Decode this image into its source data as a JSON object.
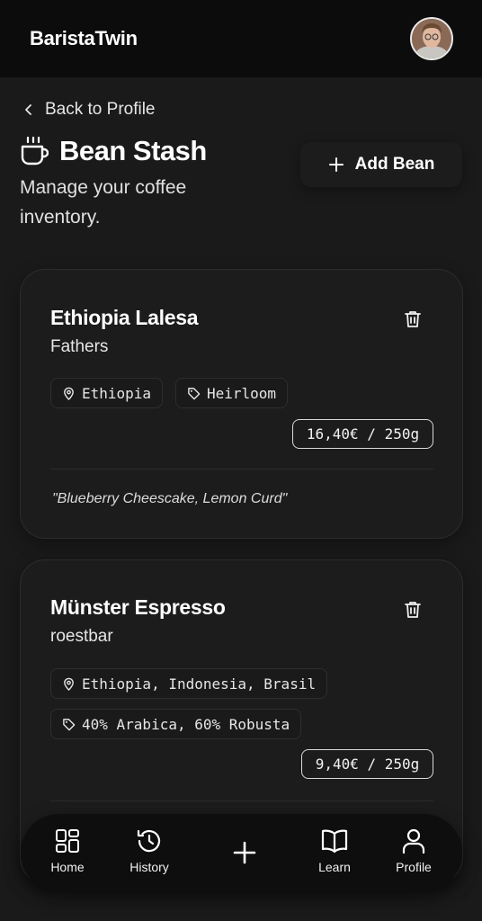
{
  "header": {
    "app_name": "BaristaTwin"
  },
  "page": {
    "back_label": "Back to Profile",
    "title": "Bean Stash",
    "subtitle": "Manage your coffee inventory.",
    "add_button": "Add Bean"
  },
  "beans": [
    {
      "name": "Ethiopia Lalesa",
      "roaster": "Fathers",
      "origin": "Ethiopia",
      "variety": "Heirloom",
      "price": "16,40€ / 250g",
      "notes": "\"Blueberry Cheescake, Lemon Curd\""
    },
    {
      "name": "Münster Espresso",
      "roaster": "roestbar",
      "origin": "Ethiopia, Indonesia, Brasil",
      "variety": "40% Arabica, 60% Robusta",
      "price": "9,40€ / 250g"
    }
  ],
  "nav": {
    "home": "Home",
    "history": "History",
    "learn": "Learn",
    "profile": "Profile"
  },
  "icons": [
    "chevron-left-icon",
    "coffee-cup-icon",
    "plus-icon",
    "trash-icon",
    "map-pin-icon",
    "tag-icon",
    "grid-icon",
    "history-icon",
    "book-icon",
    "user-icon"
  ]
}
